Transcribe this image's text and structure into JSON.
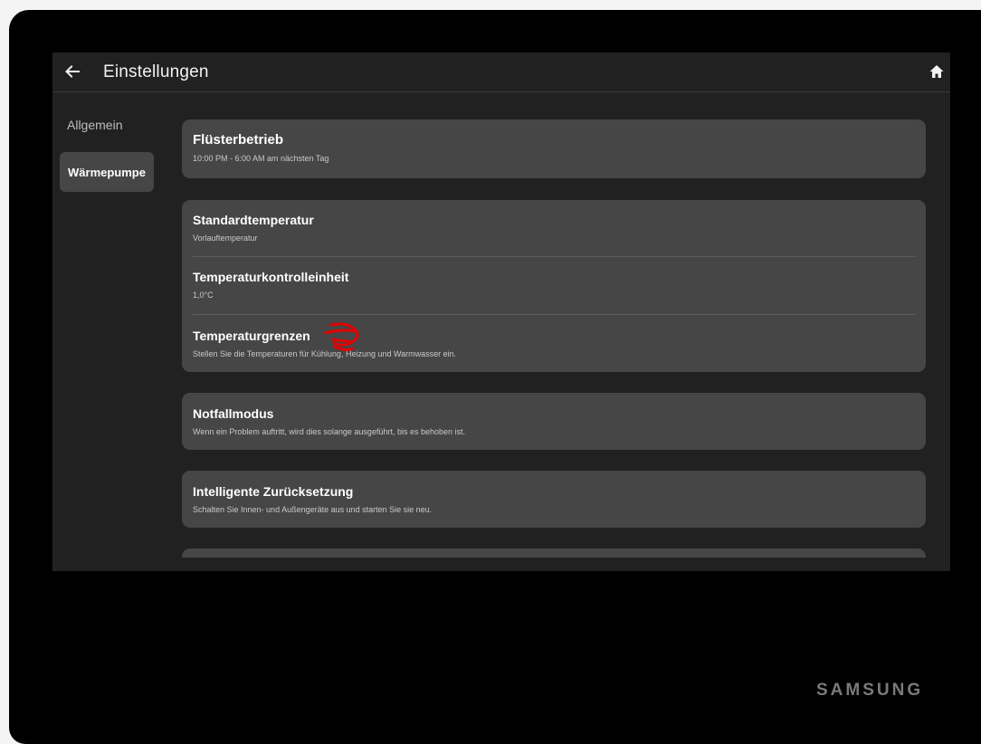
{
  "header": {
    "title": "Einstellungen",
    "back_icon": "arrow-left-icon",
    "home_icon": "home-icon"
  },
  "sidebar": {
    "items": [
      {
        "label": "Allgemein",
        "selected": false
      },
      {
        "label": "Wärmepumpe",
        "selected": true
      }
    ]
  },
  "settings": {
    "whisper": {
      "title": "Flüsterbetrieb",
      "subtitle": "10:00 PM - 6:00 AM am nächsten Tag"
    },
    "standard_temp": {
      "title": "Standardtemperatur",
      "subtitle": "Vorlauftemperatur"
    },
    "temp_unit": {
      "title": "Temperaturkontrolleinheit",
      "subtitle": "1,0°C"
    },
    "temp_limits": {
      "title": "Temperaturgrenzen",
      "subtitle": "Stellen Sie die Temperaturen für Kühlung, Heizung und Warmwasser ein."
    },
    "emergency": {
      "title": "Notfallmodus",
      "subtitle": "Wenn ein Problem auftritt, wird dies solange ausgeführt, bis es behoben ist."
    },
    "smart_reset": {
      "title": "Intelligente Zurücksetzung",
      "subtitle": "Schalten Sie Innen- und Außengeräte aus und starten Sie sie neu."
    }
  },
  "brand": "SAMSUNG",
  "colors": {
    "device_bezel": "#000000",
    "screen_bg": "#212121",
    "card_bg": "#464646",
    "annotation": "#e00000"
  }
}
